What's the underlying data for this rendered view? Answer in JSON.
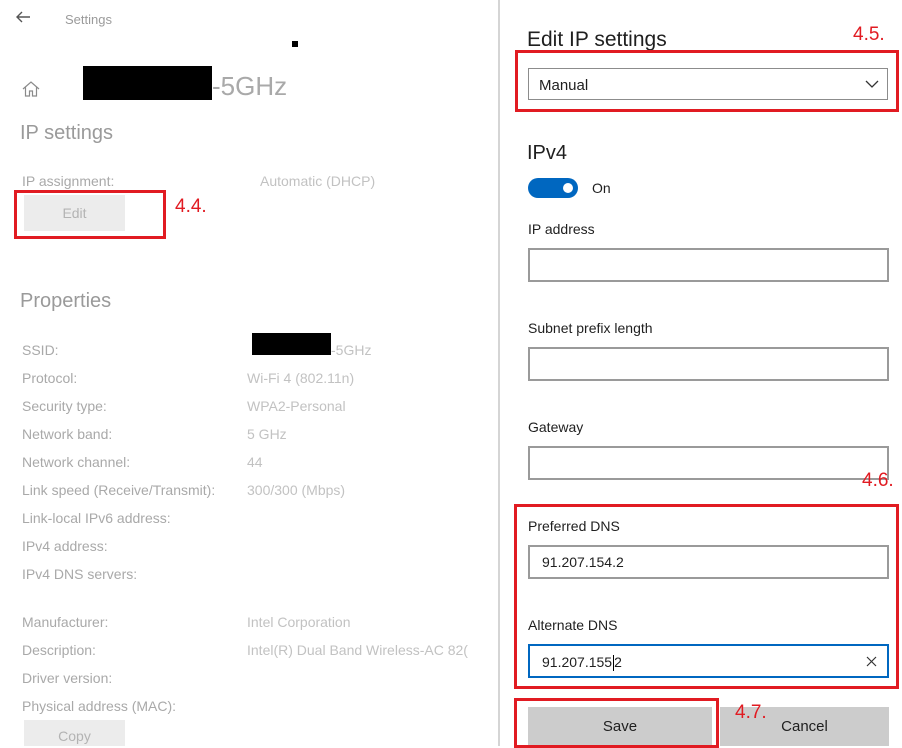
{
  "left": {
    "topbar_title": "Settings",
    "network_suffix": "-5GHz",
    "ip_settings_heading": "IP settings",
    "ip_assignment_label": "IP assignment:",
    "ip_assignment_value": "Automatic (DHCP)",
    "edit_button": "Edit",
    "properties_heading": "Properties",
    "properties": [
      {
        "label": "SSID:",
        "value": "-5GHz"
      },
      {
        "label": "Protocol:",
        "value": "Wi-Fi 4 (802.11n)"
      },
      {
        "label": "Security type:",
        "value": "WPA2-Personal"
      },
      {
        "label": "Network band:",
        "value": "5 GHz"
      },
      {
        "label": "Network channel:",
        "value": "44"
      },
      {
        "label": "Link speed (Receive/Transmit):",
        "value": "300/300 (Mbps)"
      },
      {
        "label": "Link-local IPv6 address:",
        "value": ""
      },
      {
        "label": "IPv4 address:",
        "value": ""
      },
      {
        "label": "IPv4 DNS servers:",
        "value": ""
      }
    ],
    "hardware": [
      {
        "label": "Manufacturer:",
        "value": "Intel Corporation"
      },
      {
        "label": "Description:",
        "value": "Intel(R) Dual Band Wireless-AC 82("
      },
      {
        "label": "Driver version:",
        "value": ""
      },
      {
        "label": "Physical address (MAC):",
        "value": ""
      }
    ],
    "copy_button": "Copy"
  },
  "dialog": {
    "title": "Edit IP settings",
    "mode_selected": "Manual",
    "ipv4_heading": "IPv4",
    "ipv4_toggle_label": "On",
    "ip_address_label": "IP address",
    "ip_address_value": "",
    "subnet_label": "Subnet prefix length",
    "subnet_value": "",
    "gateway_label": "Gateway",
    "gateway_value": "",
    "preferred_dns_label": "Preferred DNS",
    "preferred_dns_value": "91.207.154.2",
    "alternate_dns_label": "Alternate DNS",
    "alternate_dns_before_caret": "91.207.155",
    "alternate_dns_after_caret": "2",
    "save_button": "Save",
    "cancel_button": "Cancel"
  },
  "annotations": {
    "step_edit": "4.4.",
    "step_manual": "4.5.",
    "step_dns": "4.6.",
    "step_save": "4.7."
  },
  "colors": {
    "accent": "#0067c0",
    "annotation": "#e11b22",
    "dimmed_text": "#a9a9a9"
  }
}
